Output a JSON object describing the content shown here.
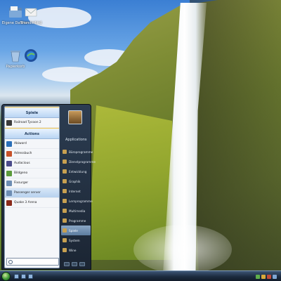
{
  "desktop": {
    "icons": [
      {
        "label": "Eigene Dateien",
        "icon": "folder-icon"
      },
      {
        "label": "Thunderbird",
        "icon": "mail-icon"
      },
      {
        "label": "Papierkorb",
        "icon": "recycle-bin-icon"
      },
      {
        "label": "",
        "icon": "google-earth-icon"
      }
    ]
  },
  "start_menu": {
    "left": {
      "recent_header": "Spiele",
      "recent_items": [
        "Railroad Tycoon 2"
      ],
      "actions_header": "Actions",
      "items": [
        "Abiword",
        "Adressbuch",
        "Audacious",
        "Bildgeno",
        "Fixsurger",
        "Passenger server",
        "Quake 3 Arena"
      ],
      "selected_index": 5,
      "search_placeholder": ""
    },
    "right": {
      "applications_label": "Applications",
      "items": [
        "Büroprogramme",
        "Dienstprogramme",
        "Entwicklung",
        "Graphik",
        "Internet",
        "Lernprogramme",
        "Multimedia",
        "Programme",
        "Spiele",
        "System",
        "Wine"
      ],
      "selected_index": 8
    }
  },
  "taskbar": {
    "clock": "",
    "start_icon": "start-orb-icon"
  },
  "colors": {
    "taskbar": "#1c2b3f",
    "menu_bg": "#1b2533",
    "selection": "#b7d1ee",
    "header_accent": "#f0c34a"
  }
}
